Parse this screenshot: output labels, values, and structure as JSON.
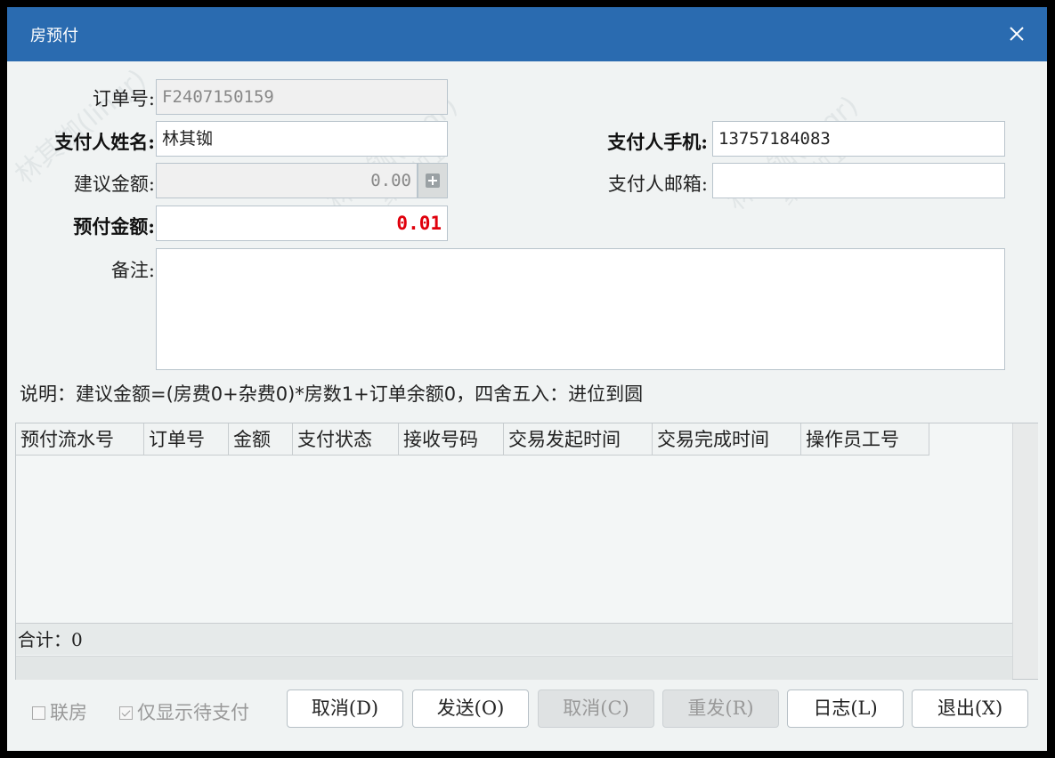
{
  "window": {
    "title": "房预付"
  },
  "form": {
    "order_no_label": "订单号:",
    "order_no_value": "F2407150159",
    "payer_name_label": "支付人姓名:",
    "payer_name_value": "林其铷",
    "payer_phone_label": "支付人手机:",
    "payer_phone_value": "13757184083",
    "suggested_amount_label": "建议金额:",
    "suggested_amount_value": "0.00",
    "payer_email_label": "支付人邮箱:",
    "payer_email_value": "",
    "prepay_amount_label": "预付金额:",
    "prepay_amount_value": "0.01",
    "remark_label": "备注:",
    "remark_value": ""
  },
  "note": "说明：建议金额=(房费0+杂费0)*房数1+订单余额0，四舍五入：进位到圆",
  "table": {
    "columns": [
      "预付流水号",
      "订单号",
      "金额",
      "支付状态",
      "接收号码",
      "交易发起时间",
      "交易完成时间",
      "操作员工号"
    ],
    "rows": [],
    "total_label": "合计：0"
  },
  "options": {
    "linked_rooms_label": "联房",
    "linked_rooms_checked": false,
    "pending_only_label": "仅显示待支付",
    "pending_only_checked": true
  },
  "buttons": {
    "cancel_d": "取消(D)",
    "send_o": "发送(O)",
    "cancel_c": "取消(C)",
    "resend_r": "重发(R)",
    "log_l": "日志(L)",
    "exit_x": "退出(X)"
  },
  "watermark": {
    "line1": "林其铷(linqr)",
    "line2": "维护机1"
  },
  "colors": {
    "titlebar": "#2a6bb0",
    "amount_red": "#e0000c",
    "window_bg": "#f0f3f3"
  }
}
